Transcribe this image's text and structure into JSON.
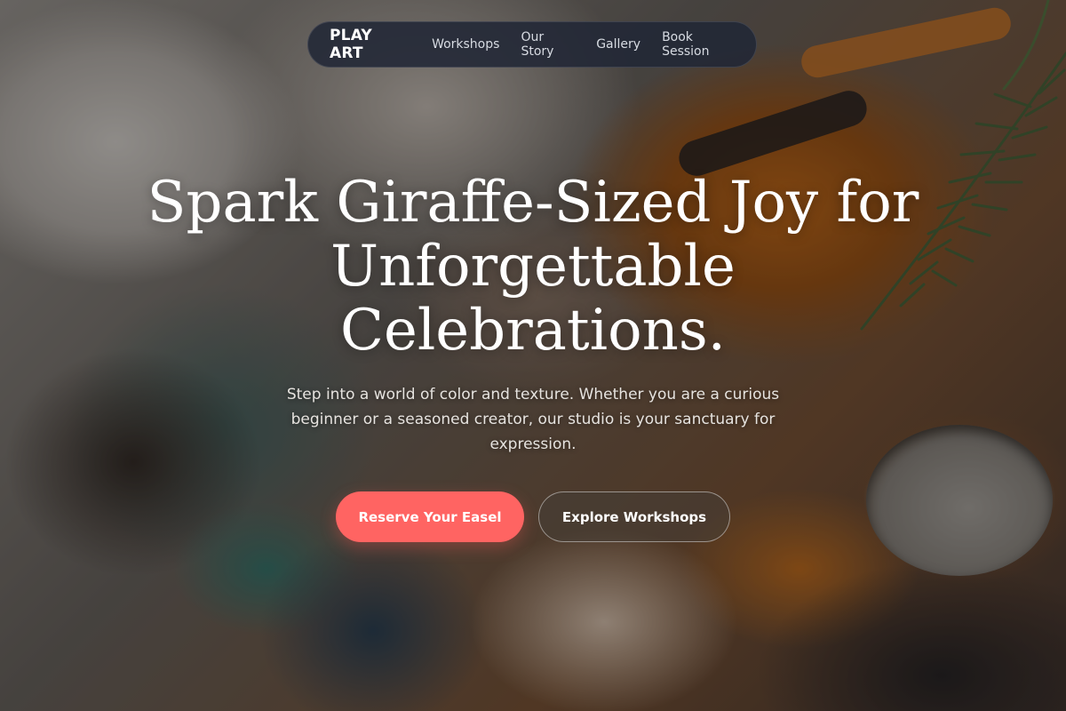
{
  "nav": {
    "brand": "PLAY ART",
    "links": [
      "Workshops",
      "Our Story",
      "Gallery",
      "Book Session"
    ]
  },
  "hero": {
    "headline_lines": [
      "Spark Giraffe-Sized Joy for",
      "Unforgettable",
      "Celebrations."
    ],
    "subtext": "Step into a world of color and texture. Whether you are a curious beginner or a seasoned creator, our studio is your sanctuary for expression.",
    "primary_cta": "Reserve Your Easel",
    "secondary_cta": "Explore Workshops"
  },
  "colors": {
    "accent": "#ff6462",
    "nav_background": "#212736"
  }
}
